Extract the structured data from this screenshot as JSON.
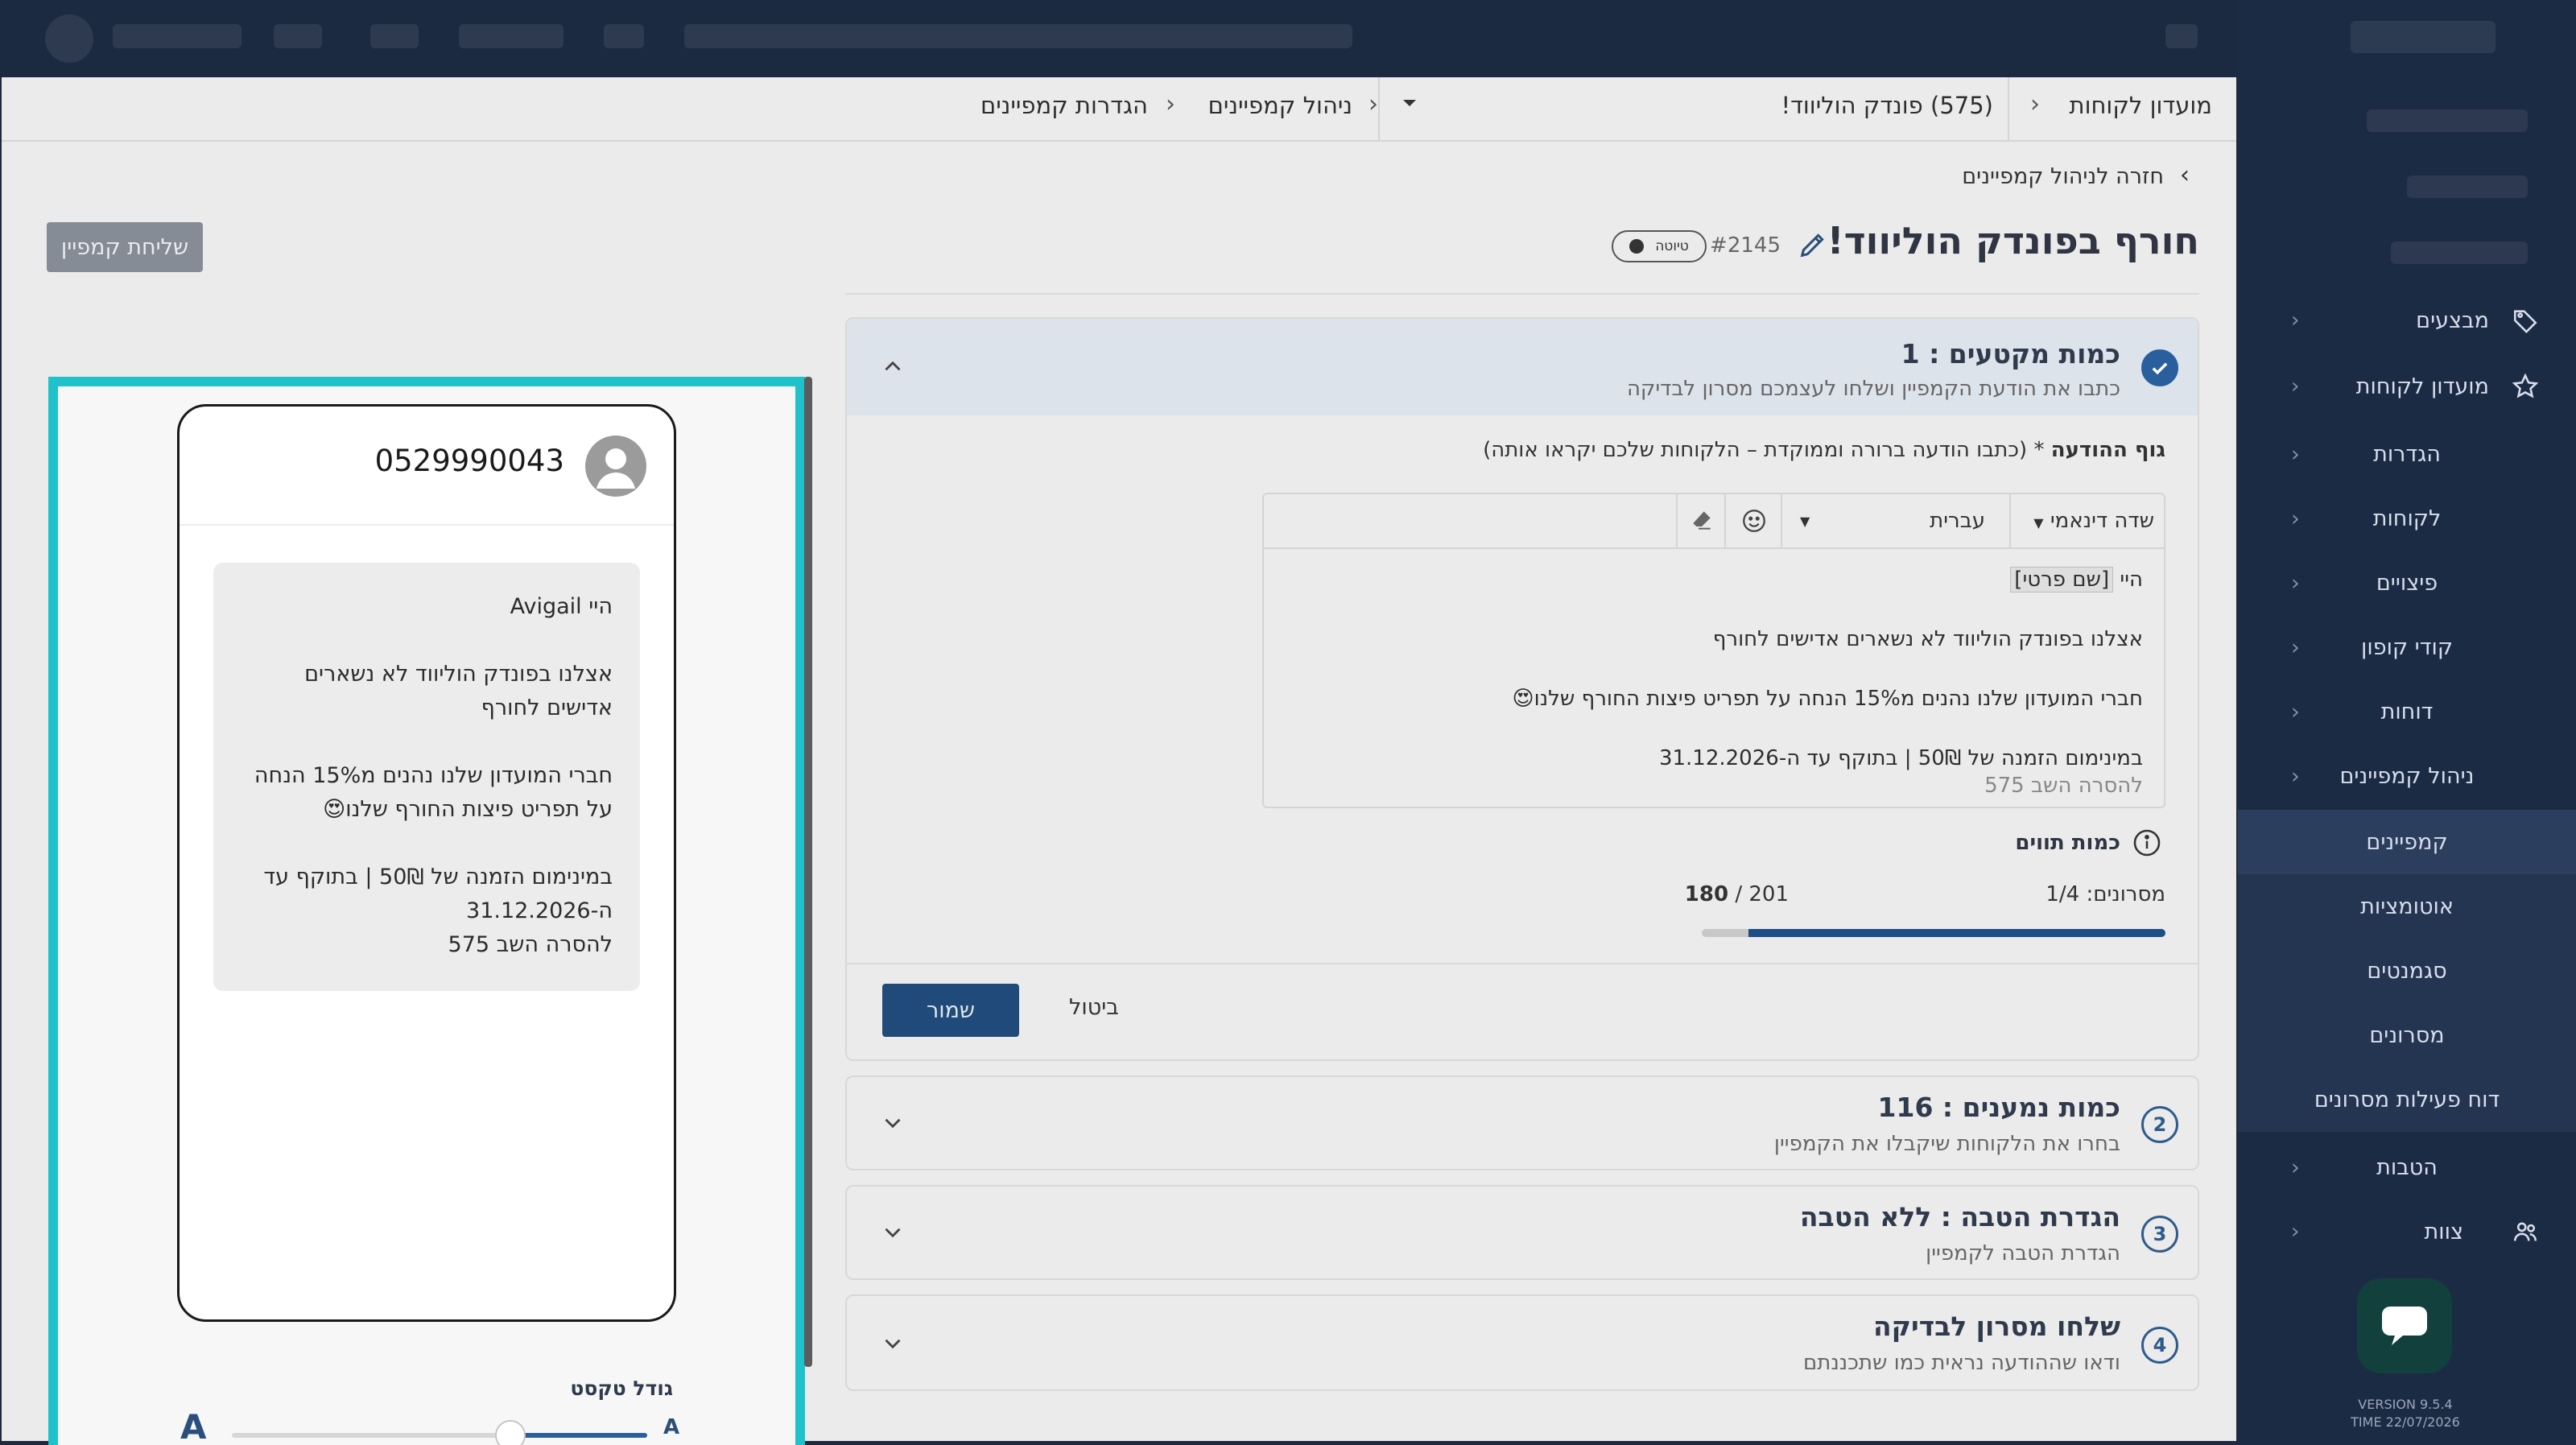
{
  "sidebar": {
    "items": [
      {
        "label": "מבצעים",
        "icon": "tag-icon"
      },
      {
        "label": "מועדון לקוחות",
        "icon": "star-icon"
      }
    ],
    "sub_items": [
      "הגדרות",
      "לקוחות",
      "פיצויים",
      "קודי קופון",
      "דוחות",
      "ניהול קמפיינים"
    ],
    "campaign_sub": [
      "קמפיינים",
      "אוטומציות",
      "סגמנטים",
      "מסרונים",
      "דוח פעילות מסרונים"
    ],
    "bottom_items": [
      {
        "label": "הטבות",
        "icon": ""
      },
      {
        "label": "צוות",
        "icon": "team-icon"
      }
    ],
    "version": "VERSION 9.5.4",
    "time": "TIME 22/07/2026"
  },
  "breadcrumbs": {
    "club": "מועדון לקוחות",
    "campaign": "(575) פונדק הוליווד!",
    "manage": "ניהול קמפיינים",
    "settings": "הגדרות קמפיינים"
  },
  "page": {
    "back_link": "חזרה לניהול קמפיינים",
    "title": "חורף בפונדק הוליווד!",
    "campaign_number": "#2145",
    "status": "טיוטה",
    "send_button": "שליחת קמפיין"
  },
  "steps": [
    {
      "number": "1",
      "title": "כמות מקטעים : 1",
      "subtitle": "כתבו את הודעת הקמפיין ושלחו לעצמכם מסרון לבדיקה"
    },
    {
      "number": "2",
      "title": "כמות נמענים : 116",
      "subtitle": "בחרו את הלקוחות שיקבלו את הקמפיין"
    },
    {
      "number": "3",
      "title": "הגדרת הטבה : ללא הטבה",
      "subtitle": "הגדרת הטבה לקמפיין"
    },
    {
      "number": "4",
      "title": "שלחו מסרון לבדיקה",
      "subtitle": "ודאו שההודעה נראית כמו שתכננתם"
    }
  ],
  "editor": {
    "label": "גוף ההודעה",
    "label_hint": "(כתבו הודעה ברורה וממוקדת – הלקוחות שלכם יקראו אותה)",
    "dynamic_field": "שדה דינאמי",
    "language": "עברית",
    "greeting": "היי",
    "name_tag": "[שם פרטי]",
    "line1": "אצלנו בפונדק הוליווד לא נשארים אדישים לחורף",
    "line2": "חברי המועדון שלנו נהנים מ15% הנחה על תפריט פיצות החורף שלנו😍",
    "line3": "במינימום הזמנה של 50₪ | בתוקף עד ה-31.12.2026",
    "unsubscribe": "להסרה השב 575"
  },
  "quota": {
    "label": "כמות תווים",
    "messages": "מסרונים: 1/4",
    "used": "180",
    "sep": " / ",
    "total": "201",
    "fill_fraction": 0.9
  },
  "actions": {
    "save": "שמור",
    "cancel": "ביטול"
  },
  "preview": {
    "phone_number": "0529990043",
    "greeting": "היי Avigail",
    "line1": "אצלנו בפונדק הוליווד לא נשארים אדישים לחורף",
    "line2": "חברי המועדון שלנו נהנים מ15% הנחה על תפריט פיצות החורף שלנו😍",
    "line3": "במינימום הזמנה של 50₪ | בתוקף עד ה-31.12.2026",
    "unsubscribe": "להסרה השב 575",
    "text_size_label": "גודל טקסט",
    "size_small": "A",
    "size_large": "A",
    "text_size_fraction": 0.33
  },
  "colors": {
    "accent": "#2a5f9e",
    "preview_border": "#1fc2cb",
    "sidebar_bg": "#1c2b44"
  }
}
